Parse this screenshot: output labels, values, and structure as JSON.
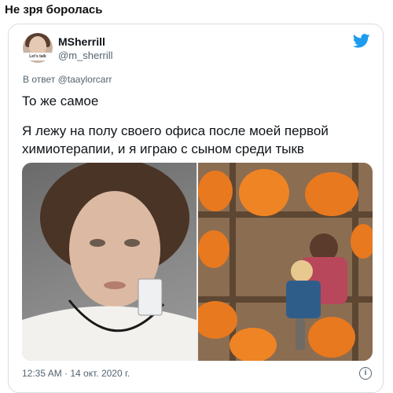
{
  "page": {
    "title": "Не зря боролась"
  },
  "tweet": {
    "author_name": "MSherrill",
    "author_handle": "@m_sherrill",
    "avatar_text": "Let's talk",
    "reply_prefix": "В ответ",
    "reply_to": "@taaylorcarr",
    "text_line1": "То же самое",
    "text_body": "Я лежу на полу своего офиса после моей первой химиотерапии, и я играю с сыном среди тыкв",
    "timestamp": "12:35 AM · 14 окт. 2020 г."
  },
  "icons": {
    "brand": "twitter-bird-icon",
    "info": "info-icon"
  },
  "colors": {
    "brand": "#1d9bf0",
    "pumpkin": "#e8791f",
    "muted": "#536471"
  }
}
